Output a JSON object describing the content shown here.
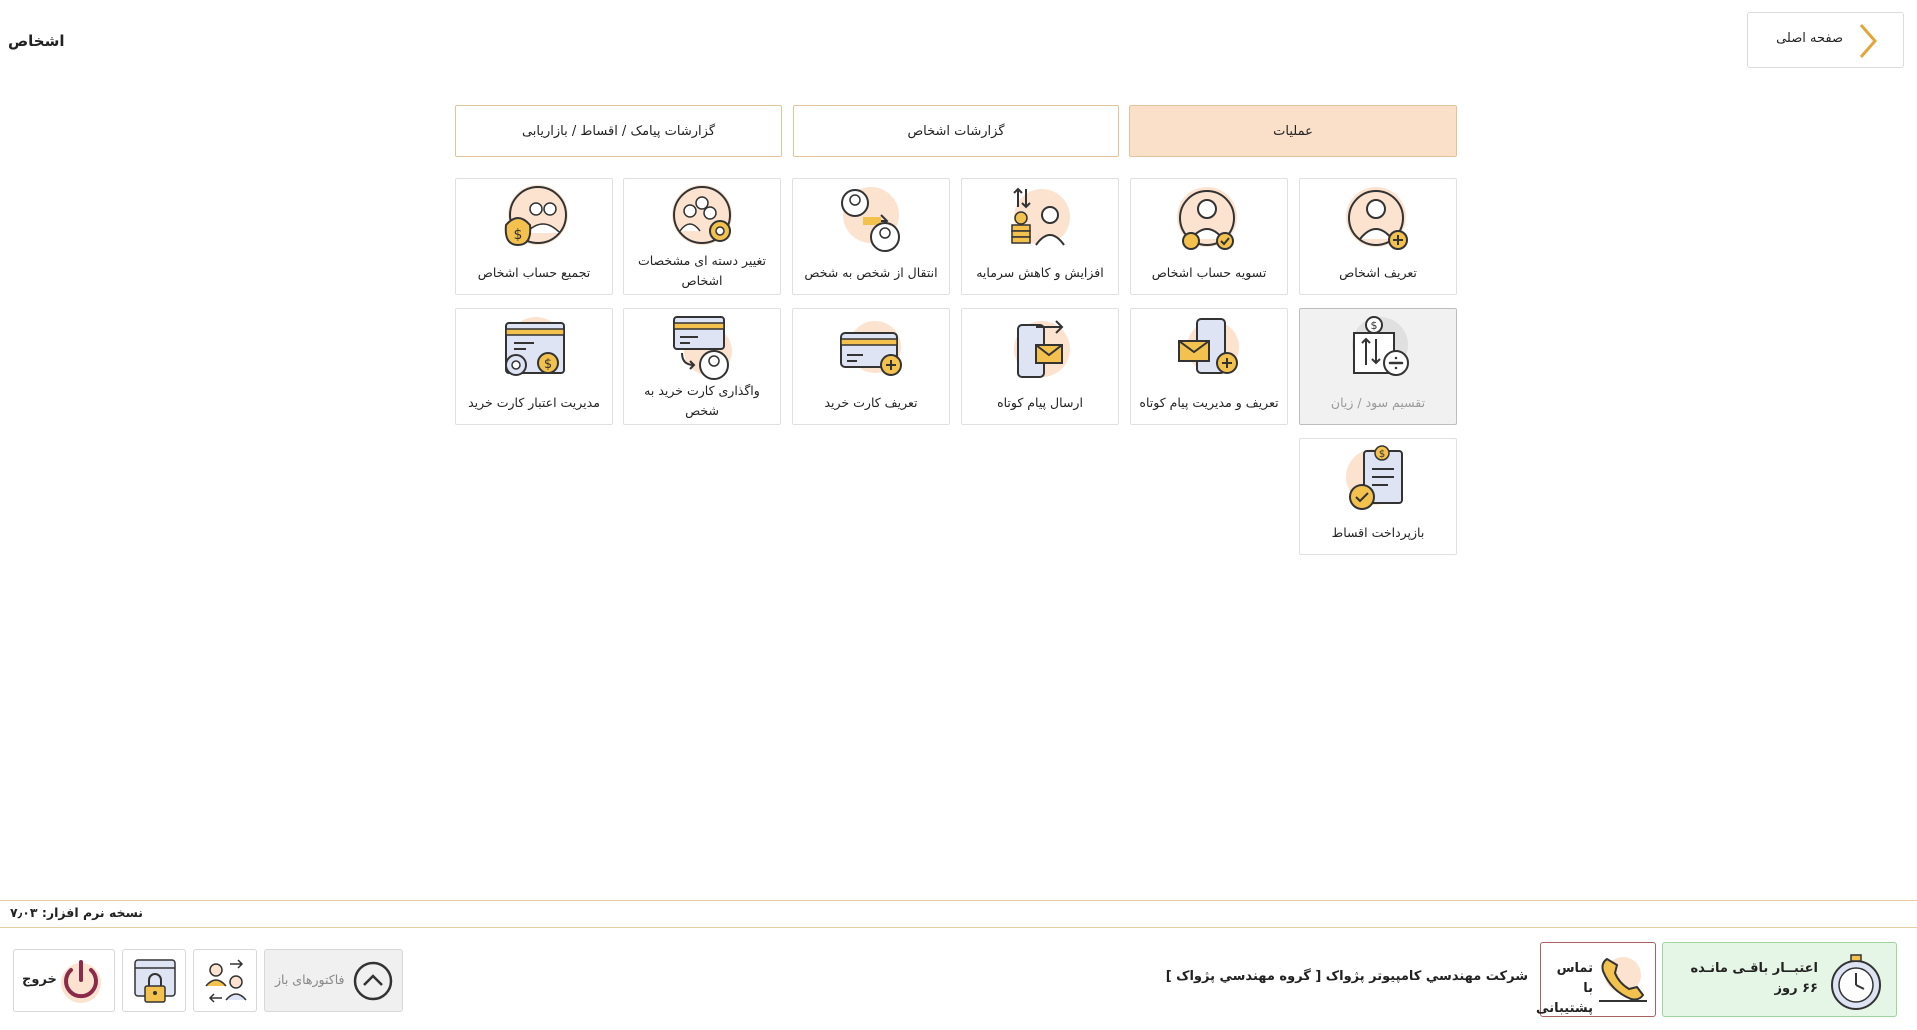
{
  "header": {
    "title": "اشخاص",
    "home_label": "صفحه اصلی"
  },
  "tabs": [
    {
      "label": "عملیات",
      "active": true
    },
    {
      "label": "گزارشات اشخاص",
      "active": false
    },
    {
      "label": "گزارشات پیامک / اقساط / بازاریابی",
      "active": false
    }
  ],
  "tiles": [
    {
      "label": "تعریف اشخاص",
      "icon": "person-add-icon"
    },
    {
      "label": "تسویه حساب اشخاص",
      "icon": "person-settle-icon"
    },
    {
      "label": "افزایش و کاهش سرمایه",
      "icon": "capital-change-icon"
    },
    {
      "label": "انتقال از شخص به شخص",
      "icon": "person-transfer-icon"
    },
    {
      "label": "تغییر دسته ای مشخصات اشخاص",
      "icon": "group-settings-icon"
    },
    {
      "label": "تجمیع حساب اشخاص",
      "icon": "group-money-icon"
    },
    {
      "label": "تقسیم سود / زیان",
      "icon": "profit-split-icon"
    },
    {
      "label": "تعریف و مدیریت پیام کوتاه",
      "icon": "sms-manage-icon"
    },
    {
      "label": "ارسال پیام کوتاه",
      "icon": "sms-send-icon"
    },
    {
      "label": "تعریف کارت خرید",
      "icon": "card-add-icon"
    },
    {
      "label": "واگذاری کارت خرید به شخص",
      "icon": "card-assign-icon"
    },
    {
      "label": "مدیریت اعتبار کارت خرید",
      "icon": "card-credit-icon"
    },
    {
      "label": "بازپرداخت اقساط",
      "icon": "installment-icon"
    }
  ],
  "footer": {
    "version": "نسخه نرم افزار: ۷٫۰۳",
    "credit_line1": "اعتبــار باقـی مانـده",
    "credit_line2": "۶۶ روز",
    "support_line1": "تماس با",
    "support_line2": "پشتیبانی",
    "company": "شرکت مهندسي کامپيوتر پژواک [ گروه مهندسي پژواک ]",
    "open_invoices": "فاکتورهای باز",
    "exit": "خروج"
  },
  "colors": {
    "accent": "#fae0c8",
    "border_accent": "#e2c49a",
    "icon_circle": "#fbe3cf",
    "credit_bg": "#e6f6e6"
  }
}
